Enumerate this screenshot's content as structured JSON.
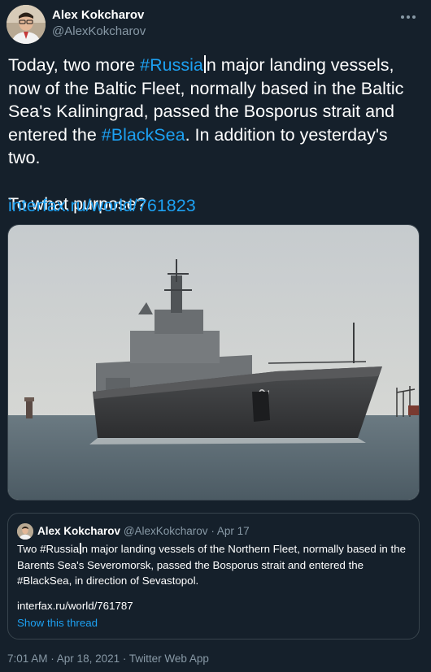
{
  "author": {
    "name": "Alex Kokcharov",
    "handle": "@AlexKokcharov"
  },
  "tweet": {
    "part1": "Today, two more ",
    "hashtag_russia": "#Russia",
    "part2": "n major landing vessels, now of the Baltic Fleet, normally based in the Baltic Sea's Kaliningrad, passed the Bosporus strait and entered the ",
    "hashtag_blacksea": "#BlackSea",
    "part3": ". In addition to yesterday's two.",
    "question": "To what purpose?",
    "link": "interfax.ru/world/761823"
  },
  "quote": {
    "name": "Alex Kokcharov",
    "handle": "@AlexKokcharov",
    "sep": " · ",
    "date": "Apr 17",
    "text_a": "Two #Russia",
    "text_b": "n major landing vessels of the Northern Fleet, normally based in the Barents Sea's Severomorsk, passed the Bosporus strait and entered the #BlackSea, in direction of Sevastopol.",
    "link": "interfax.ru/world/761787",
    "show_thread": "Show this thread"
  },
  "meta": {
    "time": "7:01 AM",
    "sep1": " · ",
    "date": "Apr 18, 2021",
    "sep2": " · ",
    "client": "Twitter Web App"
  },
  "colors": {
    "background": "#15202b",
    "link": "#1da1f2",
    "secondary": "#8899a6",
    "border": "#38444d"
  },
  "icons": {
    "more": "more-horizontal-icon"
  }
}
